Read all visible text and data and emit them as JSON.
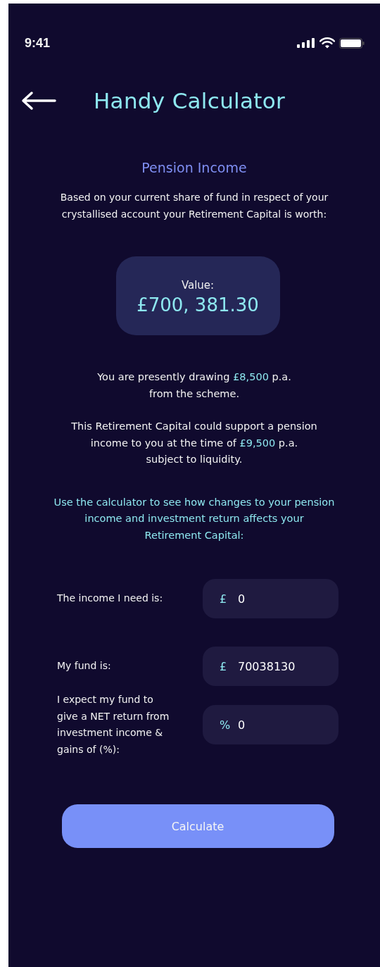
{
  "status_bar": {
    "time": "9:41"
  },
  "header": {
    "title": "Handy Calculator"
  },
  "section_title": "Pension Income",
  "intro": [
    "Based on your current share of fund in respect of your",
    "crystallised account your Retirement Capital is worth:"
  ],
  "value_card": {
    "label": "Value:",
    "amount": "£700, 381.30"
  },
  "paragraphs": [
    {
      "lines": [
        [
          {
            "text": "You are presently drawing ",
            "highlight": false
          },
          {
            "text": "£8,500",
            "highlight": true
          },
          {
            "text": " p.a.",
            "highlight": false
          }
        ],
        [
          {
            "text": "from the scheme.",
            "highlight": false
          }
        ]
      ]
    },
    {
      "lines": [
        [
          {
            "text": "This Retirement Capital could support a pension",
            "highlight": false
          }
        ],
        [
          {
            "text": "income to you at the time of ",
            "highlight": false
          },
          {
            "text": "£9,500",
            "highlight": true
          },
          {
            "text": " p.a.",
            "highlight": false
          }
        ],
        [
          {
            "text": "subject to liquidity.",
            "highlight": false
          }
        ]
      ]
    }
  ],
  "instructions": [
    "Use the calculator to see how changes to your pension",
    "income and investment return affects your",
    "Retirement Capital:"
  ],
  "fields": [
    {
      "label": "The income I need is:",
      "prefix": "£",
      "value": "0"
    },
    {
      "label": "My fund is:",
      "prefix": "£",
      "value": "70038130"
    },
    {
      "label": "I expect my fund to give a NET return from investment income & gains of (%):",
      "prefix": "%",
      "value": "0"
    }
  ],
  "button": "Calculate"
}
